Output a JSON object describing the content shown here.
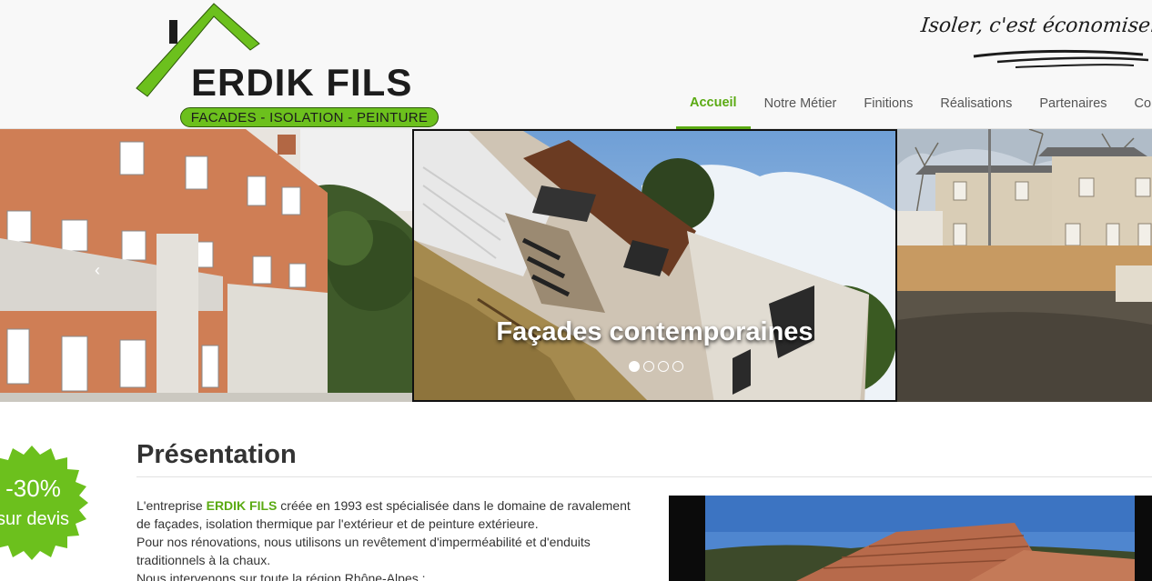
{
  "header": {
    "logo": {
      "name": "ERDIK FILS",
      "tagline": "FACADES - ISOLATION - PEINTURE"
    },
    "slogan": "Isoler, c'est économiser",
    "nav": [
      {
        "label": "Accueil",
        "active": true
      },
      {
        "label": "Notre Métier",
        "active": false
      },
      {
        "label": "Finitions",
        "active": false
      },
      {
        "label": "Réalisations",
        "active": false
      },
      {
        "label": "Partenaires",
        "active": false
      },
      {
        "label": "Conta",
        "active": false
      }
    ]
  },
  "slider": {
    "caption": "Façades contemporaines",
    "prev_icon": "‹",
    "slide_count": 4,
    "active_slide": 1
  },
  "badge": {
    "percent": "-30%",
    "label": "sur devis"
  },
  "presentation": {
    "title": "Présentation",
    "p1_before": "L'entreprise ",
    "p1_brand": "ERDIK FILS",
    "p1_after": " créée en 1993 est spécialisée dans le domaine de ravalement de façades, isolation thermique par l'extérieur et de peinture extérieure.",
    "p2": "Pour nos rénovations, nous utilisons un revêtement d'imperméabilité et d'enduits traditionnels à la chaux.",
    "p3": "Nous intervenons sur toute la région Rhône-Alpes :"
  },
  "colors": {
    "brand_green": "#6cc01d",
    "nav_active": "#5aaa12",
    "text": "#333333"
  }
}
